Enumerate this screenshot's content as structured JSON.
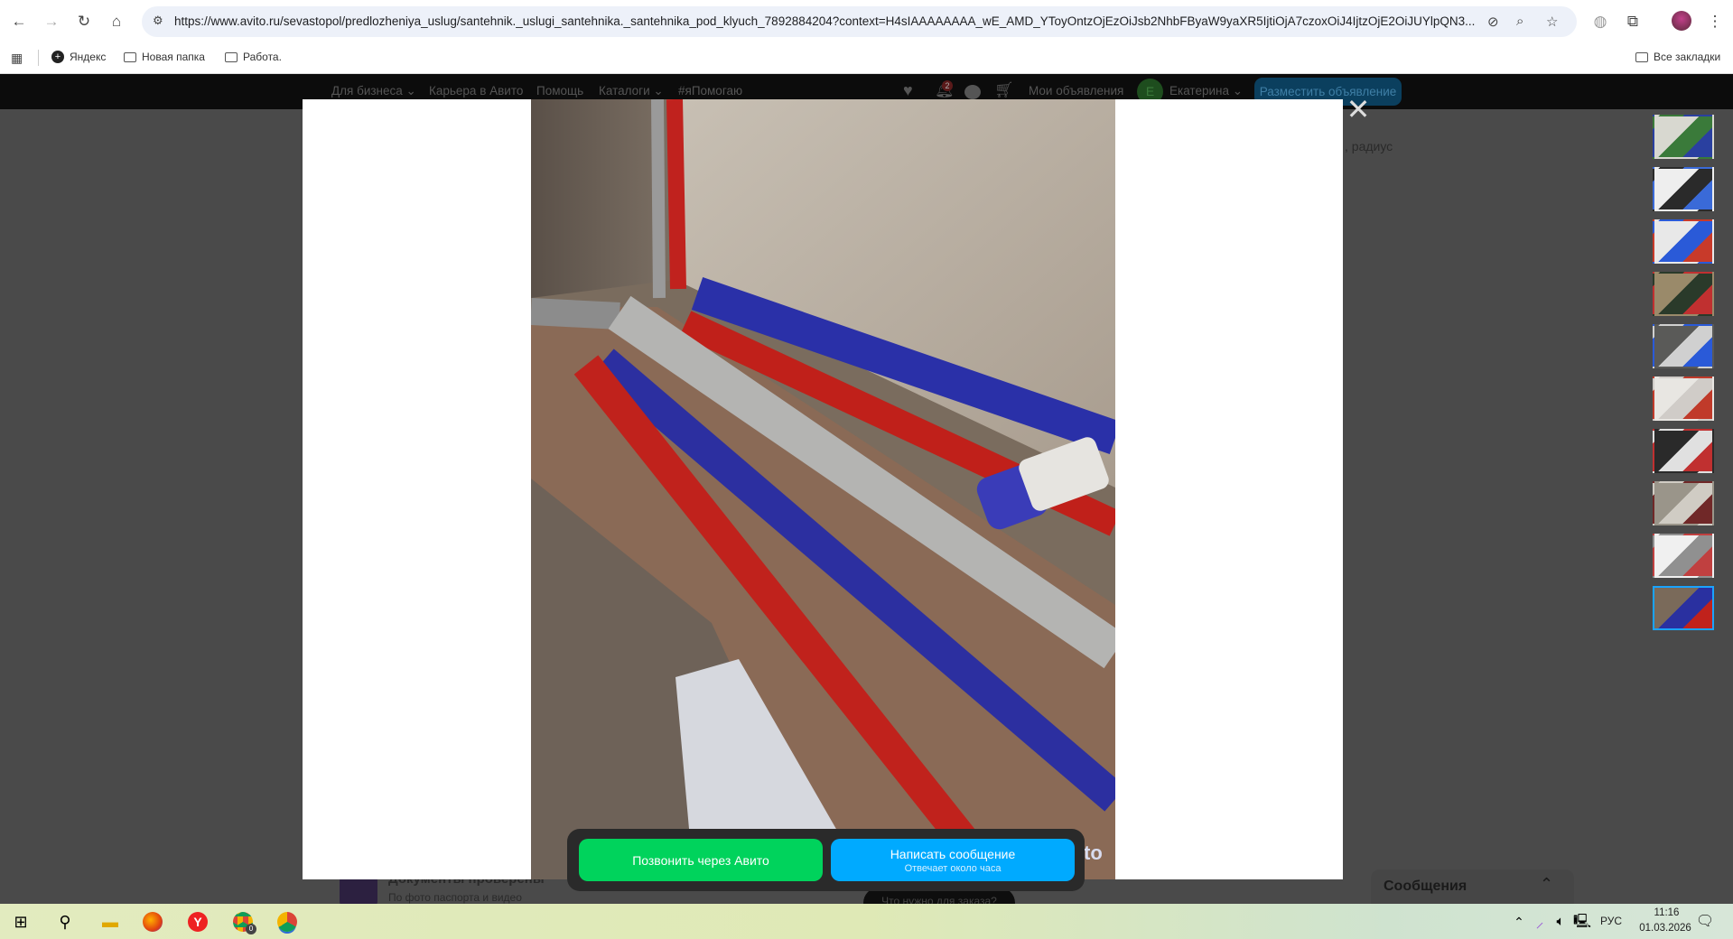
{
  "browser": {
    "url": "https://www.avito.ru/sevastopol/predlozheniya_uslug/santehnik._uslugi_santehnika._santehnika_pod_klyuch_7892884204?context=H4sIAAAAAAAA_wE_AMD_YToyOntzOjEzOiJsb2NhbFByaW9yaXR5IjtiOjA7czoxOiJ4IjtzOjE2OiJUYlpQN3...",
    "bookmarks": [
      "Яндекс",
      "Новая папка",
      "Работа."
    ],
    "all_bookmarks": "Все закладки"
  },
  "nav": {
    "items": [
      "Для бизнеса ⌄",
      "Карьера в Авито",
      "Помощь",
      "Каталоги ⌄",
      "#яПомогаю"
    ],
    "notification_count": "2",
    "my_ads": "Мои объявления",
    "avatar_letter": "Е",
    "user": "Екатерина ⌄",
    "post_button": "Разместить объявление"
  },
  "background": {
    "radius_text": ", радиус",
    "docs_title": "Документы проверены",
    "docs_sub": "По фото паспорта и видео",
    "order_question": "Что нужно для заказа?",
    "messages": "Сообщения"
  },
  "gallery": {
    "thumbnail_count": 10,
    "selected_index": 9,
    "watermark": "to"
  },
  "actions": {
    "call": "Позвонить через Авито",
    "message": "Написать сообщение",
    "message_sub": "Отвечает около часа"
  },
  "taskbar": {
    "lang": "РУС",
    "time": "11:16",
    "date": "01.03.2026",
    "chrome_badge": "0"
  }
}
